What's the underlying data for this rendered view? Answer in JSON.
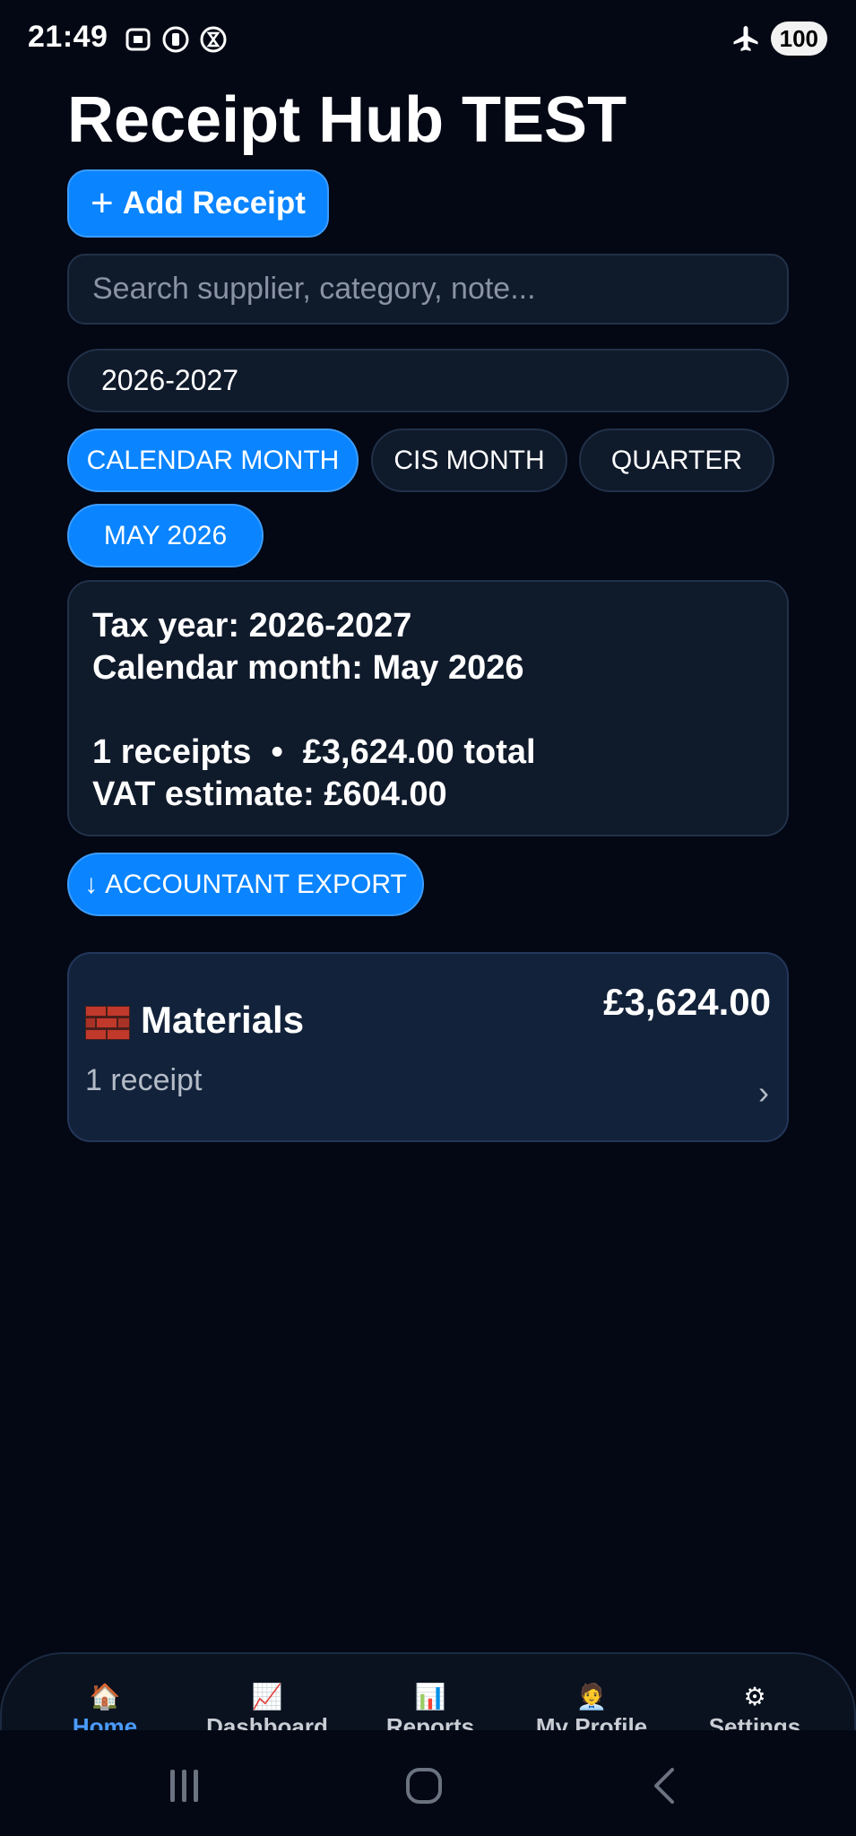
{
  "status_bar": {
    "time": "21:49",
    "battery": "100"
  },
  "app": {
    "title": "Receipt Hub TEST"
  },
  "actions": {
    "add_receipt_label": "Add Receipt",
    "add_icon": "+"
  },
  "search": {
    "placeholder": "Search supplier, category, note...",
    "value": ""
  },
  "filters": {
    "tax_year": "2026-2027",
    "period_types": [
      {
        "label": "CALENDAR MONTH",
        "selected": true
      },
      {
        "label": "CIS MONTH",
        "selected": false
      },
      {
        "label": "QUARTER",
        "selected": false
      }
    ],
    "selected_period": "MAY 2026"
  },
  "summary": {
    "tax_year_line": "Tax year: 2026-2027",
    "period_line": "Calendar month: May 2026",
    "receipts_count": "1 receipts",
    "separator": "•",
    "total": "£3,624.00 total",
    "vat_line": "VAT estimate: £604.00"
  },
  "export": {
    "icon": "↓",
    "label": "ACCOUNTANT EXPORT"
  },
  "categories": [
    {
      "icon": "brick-icon",
      "name": "Materials",
      "amount": "£3,624.00",
      "count": "1 receipt",
      "chevron": "›"
    }
  ],
  "bottom_nav": {
    "items": [
      {
        "label": "Home",
        "icon": "🏠",
        "active": true
      },
      {
        "label": "Dashboard",
        "icon": "📈",
        "active": false
      },
      {
        "label": "Reports",
        "icon": "📊",
        "active": false
      },
      {
        "label": "My Profile",
        "icon": "🧑‍💼",
        "active": false
      },
      {
        "label": "Settings",
        "icon": "⚙",
        "active": false
      }
    ]
  },
  "colors": {
    "accent": "#0a84ff",
    "background": "#030814",
    "card": "#0f1a2b",
    "category_card": "#12223b"
  }
}
